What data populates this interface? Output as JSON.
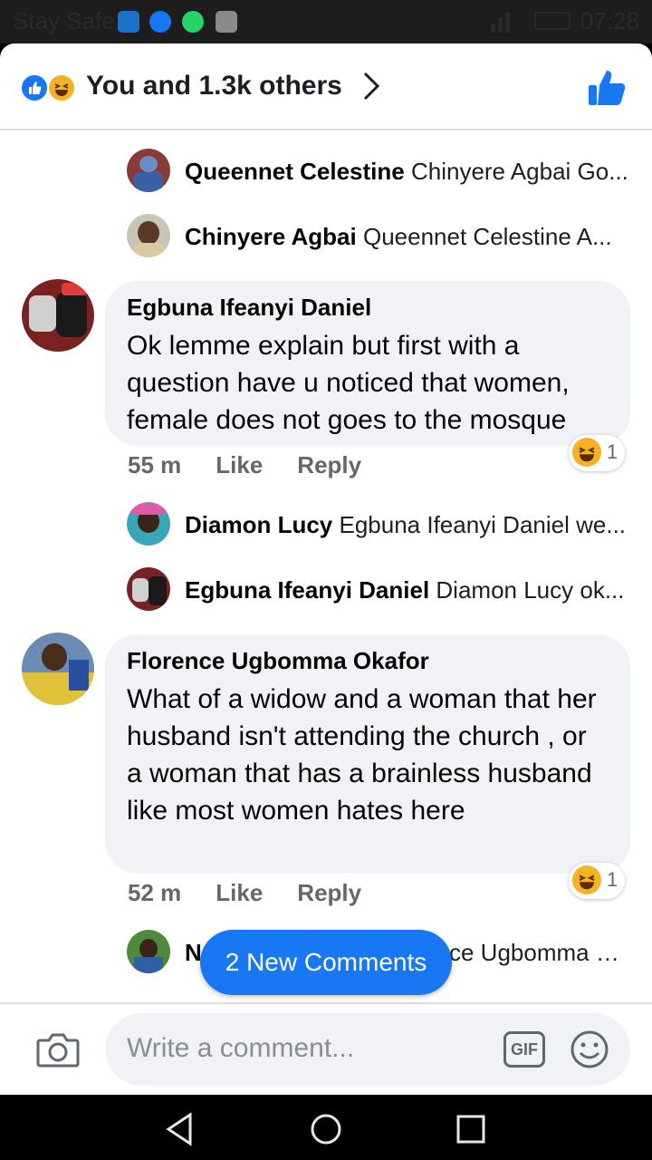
{
  "status_bar": {
    "carrier": "Stay Safe",
    "time": "07:28"
  },
  "header": {
    "title": "You and 1.3k others"
  },
  "comments": [
    {
      "type": "reply",
      "author": "Queennet Celestine",
      "preview": "Chinyere Agbai Go..."
    },
    {
      "type": "reply",
      "author": "Chinyere Agbai",
      "preview": "Queennet Celestine A..."
    },
    {
      "type": "comment",
      "author": "Egbuna Ifeanyi Daniel",
      "text": "Ok lemme explain but first with a question have u noticed that women, female does not goes to the mosque",
      "time": "55 m",
      "like_label": "Like",
      "reply_label": "Reply",
      "reaction_count": "1"
    },
    {
      "type": "reply",
      "author": "Diamon Lucy",
      "preview": "Egbuna Ifeanyi Daniel we..."
    },
    {
      "type": "reply",
      "author": "Egbuna Ifeanyi Daniel",
      "preview": "Diamon Lucy ok..."
    },
    {
      "type": "comment",
      "author": "Florence Ugbomma Okafor",
      "text": "What of a widow and a woman that her husband isn't attending the church , or a woman that has a brainless husband like most women hates here",
      "time": "52 m",
      "like_label": "Like",
      "reply_label": "Reply",
      "reaction_count": "1"
    },
    {
      "type": "reply",
      "author": "N",
      "preview": "ce Ugbomma O..."
    }
  ],
  "new_comments_label": "2 New Comments",
  "composer": {
    "placeholder": "Write a comment...",
    "gif_label": "GIF"
  },
  "icons": {
    "reaction_like": "like-icon",
    "reaction_haha": "haha-icon",
    "header_like": "thumbs-up-icon",
    "camera": "camera-icon",
    "smile": "smile-icon",
    "nav_back": "back-triangle-icon",
    "nav_home": "home-circle-icon",
    "nav_recent": "recent-square-icon"
  },
  "colors": {
    "accent": "#1877f2",
    "bubble": "#f0f2f5",
    "muted": "#65676b",
    "haha": "#f7b125"
  }
}
